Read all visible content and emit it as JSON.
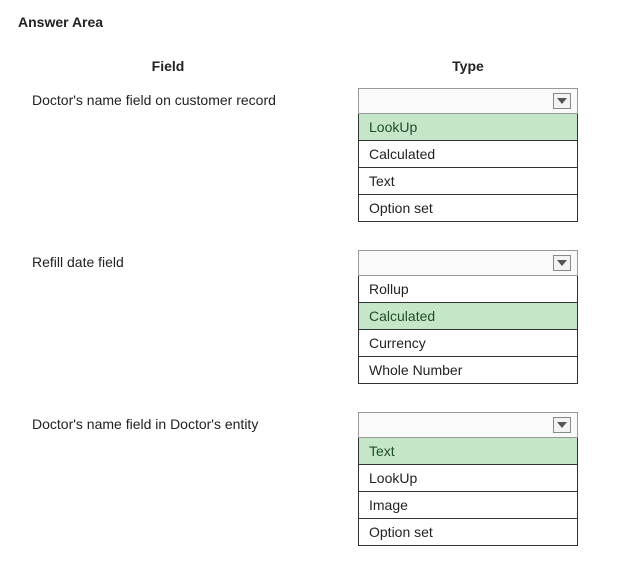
{
  "title": "Answer Area",
  "headers": {
    "field": "Field",
    "type": "Type"
  },
  "rows": [
    {
      "label": "Doctor's name field on customer record",
      "options": [
        "LookUp",
        "Calculated",
        "Text",
        "Option set"
      ],
      "selected": 0
    },
    {
      "label": "Refill date field",
      "options": [
        "Rollup",
        "Calculated",
        "Currency",
        "Whole Number"
      ],
      "selected": 1
    },
    {
      "label": "Doctor's name field in Doctor's entity",
      "options": [
        "Text",
        "LookUp",
        "Image",
        "Option set"
      ],
      "selected": 0
    }
  ]
}
